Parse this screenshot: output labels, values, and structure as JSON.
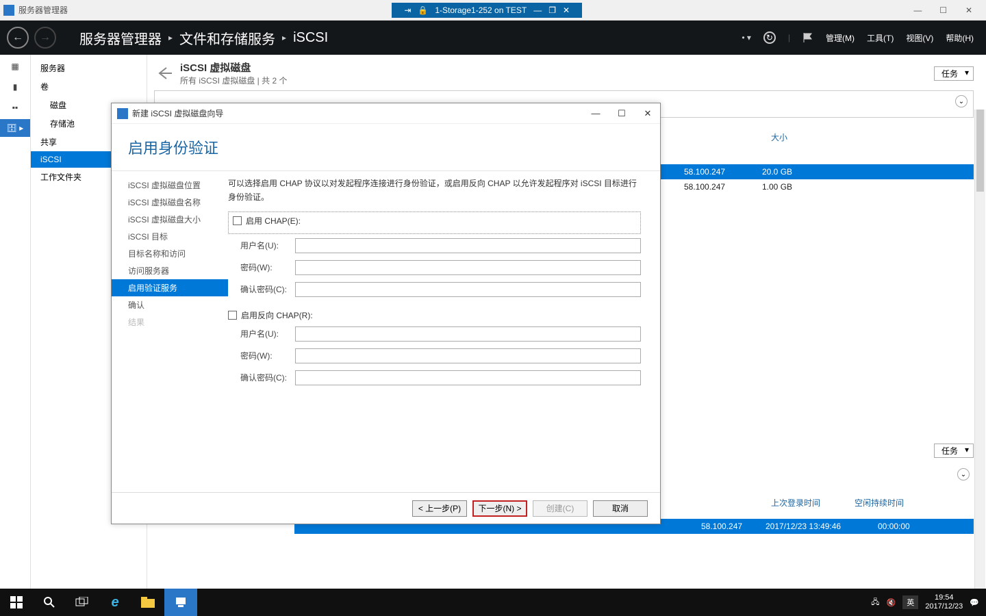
{
  "outer": {
    "app_title": "服务器管理器",
    "vm_tab": "1-Storage1-252 on TEST"
  },
  "header": {
    "crumb1": "服务器管理器",
    "crumb2": "文件和存储服务",
    "crumb3": "iSCSI",
    "menu_manage": "管理(M)",
    "menu_tools": "工具(T)",
    "menu_view": "视图(V)",
    "menu_help": "帮助(H)"
  },
  "nav": {
    "servers": "服务器",
    "volumes": "卷",
    "disks": "磁盘",
    "pools": "存储池",
    "shares": "共享",
    "iscsi": "iSCSI",
    "workfolders": "工作文件夹"
  },
  "panel": {
    "title": "iSCSI 虚拟磁盘",
    "subtitle": "所有 iSCSI 虚拟磁盘 | 共 2 个",
    "tasks": "任务",
    "col_size": "大小",
    "row1_ip": "58.100.247",
    "row1_size": "20.0 GB",
    "row2_ip": "58.100.247",
    "row2_size": "1.00 GB",
    "col_last_login": "上次登录时间",
    "col_idle": "空闲持续时间",
    "row3_ip": "58.100.247",
    "row3_time": "2017/12/23 13:49:46",
    "row3_idle": "00:00:00"
  },
  "wizard": {
    "title": "新建 iSCSI 虚拟磁盘向导",
    "heading": "启用身份验证",
    "steps": {
      "loc": "iSCSI 虚拟磁盘位置",
      "name": "iSCSI 虚拟磁盘名称",
      "size": "iSCSI 虚拟磁盘大小",
      "target": "iSCSI 目标",
      "targetname": "目标名称和访问",
      "access": "访问服务器",
      "auth": "启用验证服务",
      "confirm": "确认",
      "result": "结果"
    },
    "desc": "可以选择启用 CHAP 协议以对发起程序连接进行身份验证，或启用反向 CHAP 以允许发起程序对 iSCSI 目标进行身份验证。",
    "chap_enable": "启用 CHAP(E):",
    "rchap_enable": "启用反向 CHAP(R):",
    "user": "用户名(U):",
    "pwd": "密码(W):",
    "cpwd": "确认密码(C):",
    "btn_prev": "< 上一步(P)",
    "btn_next": "下一步(N) >",
    "btn_create": "创建(C)",
    "btn_cancel": "取消"
  },
  "taskbar": {
    "ime": "英",
    "time": "19:54",
    "date": "2017/12/23"
  }
}
